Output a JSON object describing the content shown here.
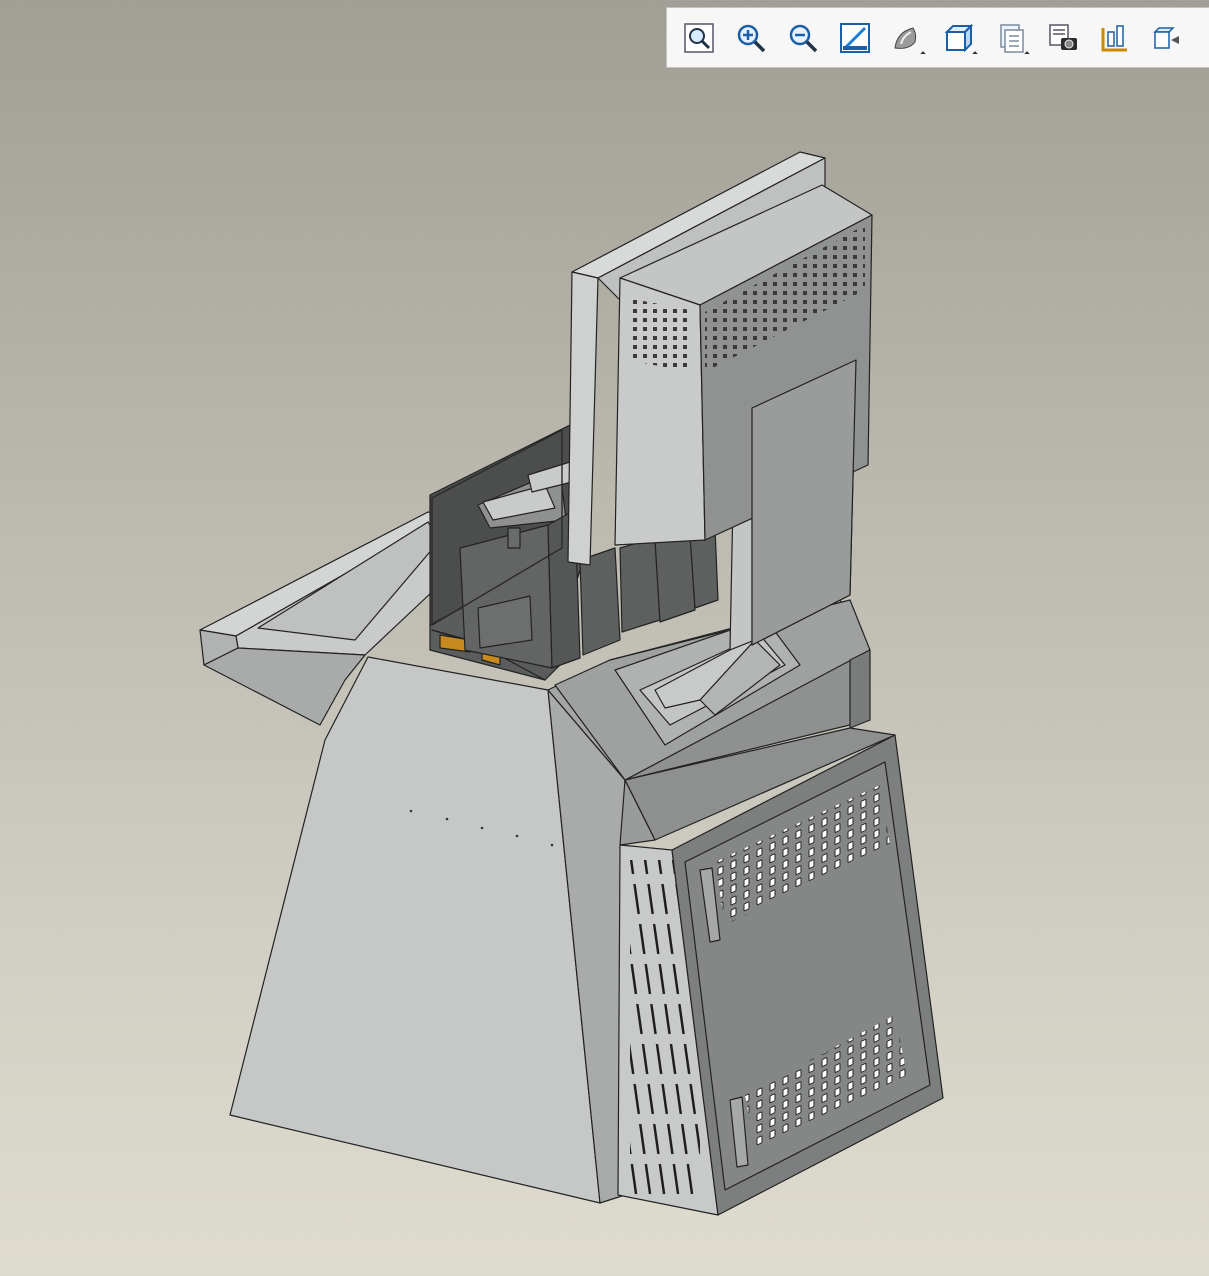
{
  "toolbar": {
    "buttons": [
      {
        "name": "refit-icon",
        "dropdown": false
      },
      {
        "name": "zoom-in-icon",
        "dropdown": false
      },
      {
        "name": "zoom-out-icon",
        "dropdown": false
      },
      {
        "name": "repaint-icon",
        "dropdown": false
      },
      {
        "name": "display-style-icon",
        "dropdown": true
      },
      {
        "name": "saved-views-icon",
        "dropdown": true
      },
      {
        "name": "layers-icon",
        "dropdown": true
      },
      {
        "name": "screenshot-icon",
        "dropdown": false
      },
      {
        "name": "datum-display-icon",
        "dropdown": false
      },
      {
        "name": "annotation-icon",
        "dropdown": false
      }
    ]
  },
  "colors": {
    "background_top": "#a19f95",
    "background_bottom": "#dfdccf",
    "panel_light": "#c6c8c8",
    "panel_mid": "#a8aaaa",
    "panel_dark": "#6f7070",
    "accent_orange": "#c88a1e",
    "edge": "#222222"
  }
}
